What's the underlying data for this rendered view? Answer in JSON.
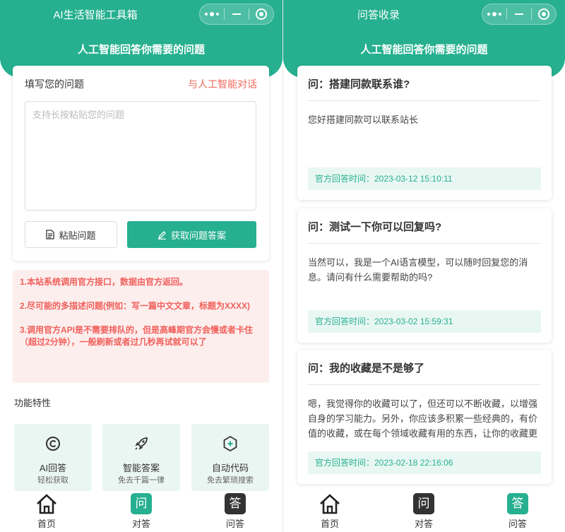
{
  "left": {
    "window_title": "AI生活智能工具箱",
    "subtitle": "人工智能回答你需要的问题",
    "form": {
      "label": "填写您的问题",
      "chat_link": "与人工智能对话",
      "placeholder": "支持长按粘贴您的问题",
      "paste_button": "粘贴问题",
      "submit_button": "获取问题答案"
    },
    "notices": [
      "1.本站系统调用官方接口，数据由官方返回。",
      "2.尽可能的多描述问题(例如：写一篇中文文章，标题为XXXX)",
      "3.调用官方API是不需要排队的，但是高峰期官方会慢或者卡住（超过2分钟），一般刷新或者过几秒再试就可以了"
    ],
    "features_title": "功能特性",
    "features": [
      {
        "name": "AI回答",
        "sub": "轻松获取",
        "icon": "copyright-c-icon"
      },
      {
        "name": "智能答案",
        "sub": "免去千篇一律",
        "icon": "rocket-icon"
      },
      {
        "name": "自动代码",
        "sub": "免去繁琐搜索",
        "icon": "hex-plus-icon"
      }
    ],
    "tabs": [
      {
        "label": "首页",
        "icon": "home-icon",
        "glyph": ""
      },
      {
        "label": "对答",
        "icon": "question-icon",
        "glyph": "问"
      },
      {
        "label": "问答",
        "icon": "answer-icon",
        "glyph": "答"
      }
    ]
  },
  "right": {
    "window_title": "问答收录",
    "subtitle": "人工智能回答你需要的问题",
    "items": [
      {
        "question": "问：搭建同款联系谁?",
        "answer": "您好搭建同款可以联系站长",
        "time": "官方回答时间：2023-03-12 15:10:11"
      },
      {
        "question": "问：测试一下你可以回复吗?",
        "answer": "当然可以，我是一个AI语言模型，可以随时回复您的消息。请问有什么需要帮助的吗?",
        "time": "官方回答时间：2023-03-02 15:59:31"
      },
      {
        "question": "问：我的收藏是不是够了",
        "answer": "嗯，我觉得你的收藏可以了，但还可以不断收藏，以增强自身的学习能力。另外，你应该多积累一些经典的，有价值的收藏，或在每个领域收藏有用的东西，让你的收藏更加丰富和全面。",
        "time": "官方回答时间：2023-02-18 22:16:06"
      }
    ],
    "tabs": [
      {
        "label": "首页",
        "icon": "home-icon",
        "glyph": ""
      },
      {
        "label": "对答",
        "icon": "question-icon",
        "glyph": "问"
      },
      {
        "label": "问答",
        "icon": "answer-icon",
        "glyph": "答"
      }
    ]
  },
  "colors": {
    "accent": "#26b08f",
    "danger": "#f06a5c",
    "notice_bg": "#fdeeee",
    "tab_dark": "#333333"
  }
}
